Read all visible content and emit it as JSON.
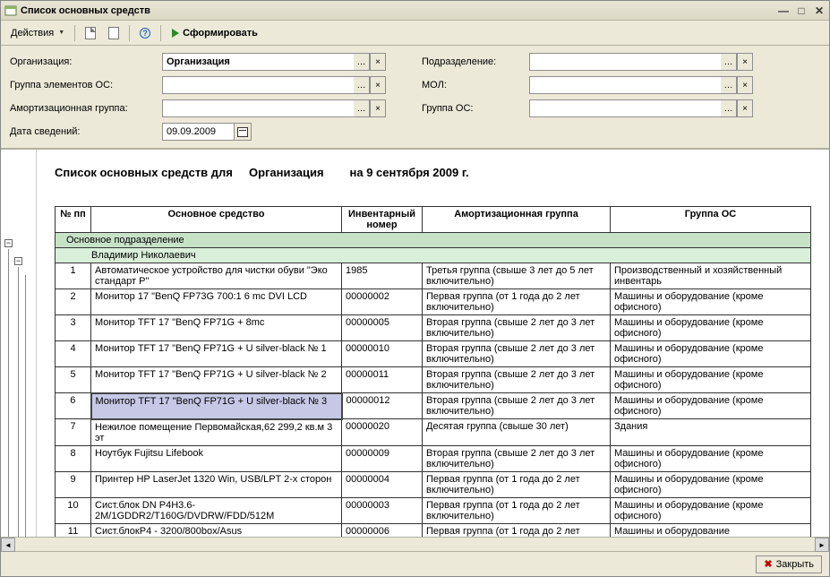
{
  "window": {
    "title": "Список основных средств"
  },
  "toolbar": {
    "actions_label": "Действия",
    "form_label": "Сформировать"
  },
  "filters": {
    "org_label": "Организация:",
    "org_value": "Организация",
    "elem_group_label": "Группа элементов ОС:",
    "elem_group_value": "",
    "amort_group_label": "Амортизационная группа:",
    "amort_group_value": "",
    "date_label": "Дата сведений:",
    "date_value": "09.09.2009",
    "dept_label": "Подразделение:",
    "dept_value": "",
    "mol_label": "МОЛ:",
    "mol_value": "",
    "os_group_label": "Группа ОС:",
    "os_group_value": ""
  },
  "report": {
    "title_prefix": "Список основных средств для",
    "title_org": "Организация",
    "title_date": "на 9 сентября 2009 г.",
    "columns": {
      "num": "№ пп",
      "name": "Основное средство",
      "inv": "Инвентарный номер",
      "amort": "Амортизационная группа",
      "grp": "Группа ОС"
    },
    "group1": "Основное подразделение",
    "group2": "Владимир Николаевич",
    "rows": [
      {
        "num": "1",
        "name": "Автоматическое устройство для чистки обуви \"Эко стандарт Р\"",
        "inv": "1985",
        "amort": "Третья группа (свыше 3 лет до 5 лет включительно)",
        "grp": "Производственный и хозяйственный инвентарь"
      },
      {
        "num": "2",
        "name": "Монитор 17 \"BenQ FP73G 700:1 6 mc DVI LCD",
        "inv": "00000002",
        "amort": "Первая группа (от 1 года до 2 лет включительно)",
        "grp": "Машины и оборудование (кроме офисного)"
      },
      {
        "num": "3",
        "name": "Монитор TFT 17 \"BenQ FP71G + 8mc",
        "inv": "00000005",
        "amort": "Вторая группа (свыше 2 лет до 3 лет включительно)",
        "grp": "Машины и оборудование (кроме офисного)"
      },
      {
        "num": "4",
        "name": "Монитор TFT 17 \"BenQ FP71G + U silver-black № 1",
        "inv": "00000010",
        "amort": "Вторая группа (свыше 2 лет до 3 лет включительно)",
        "grp": "Машины и оборудование (кроме офисного)"
      },
      {
        "num": "5",
        "name": "Монитор TFT 17 \"BenQ FP71G + U silver-black № 2",
        "inv": "00000011",
        "amort": "Вторая группа (свыше 2 лет до 3 лет включительно)",
        "grp": "Машины и оборудование (кроме офисного)"
      },
      {
        "num": "6",
        "name": "Монитор TFT 17 \"BenQ FP71G + U silver-black № 3",
        "inv": "00000012",
        "amort": "Вторая группа (свыше 2 лет до 3 лет включительно)",
        "grp": "Машины и оборудование (кроме офисного)"
      },
      {
        "num": "7",
        "name": "Нежилое помещение Первомайская,62 299,2 кв.м 3 эт",
        "inv": "00000020",
        "amort": "Десятая группа (свыше 30 лет)",
        "grp": "Здания"
      },
      {
        "num": "8",
        "name": "Ноутбук Fujitsu Lifebook",
        "inv": "00000009",
        "amort": "Вторая группа (свыше 2 лет до 3 лет включительно)",
        "grp": "Машины и оборудование (кроме офисного)"
      },
      {
        "num": "9",
        "name": "Принтер HP LaserJet 1320 Win, USB/LPT 2-х сторон",
        "inv": "00000004",
        "amort": "Первая группа (от 1 года до 2 лет включительно)",
        "grp": "Машины и оборудование (кроме офисного)"
      },
      {
        "num": "10",
        "name": "Сист.блок DN P4H3.6-2M/1GDDR2/T160G/DVDRW/FDD/512M",
        "inv": "00000003",
        "amort": "Первая группа (от 1 года до 2 лет включительно)",
        "grp": "Машины и оборудование (кроме офисного)"
      },
      {
        "num": "11",
        "name": "Сист.блокP4 - 3200/800box/Asus",
        "inv": "00000006",
        "amort": "Первая группа (от 1 года до 2 лет",
        "grp": "Машины и оборудование"
      }
    ],
    "selected_row_index": 5
  },
  "footer": {
    "close_label": "Закрыть"
  }
}
